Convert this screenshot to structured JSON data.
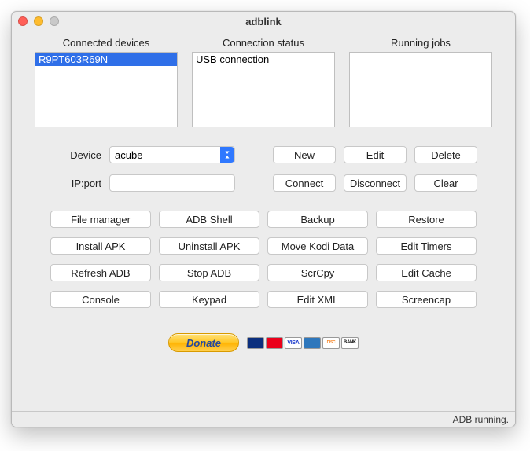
{
  "window": {
    "title": "adblink"
  },
  "panes": {
    "connected_devices": {
      "label": "Connected devices",
      "items": [
        "R9PT603R69N"
      ],
      "selected_index": 0
    },
    "connection_status": {
      "label": "Connection status",
      "text": "USB connection"
    },
    "running_jobs": {
      "label": "Running jobs",
      "text": ""
    }
  },
  "form": {
    "device_label": "Device",
    "device_value": "acube",
    "ipport_label": "IP:port",
    "ipport_value": "",
    "buttons": {
      "new": "New",
      "edit": "Edit",
      "delete": "Delete",
      "connect": "Connect",
      "disconnect": "Disconnect",
      "clear": "Clear"
    }
  },
  "grid": {
    "file_manager": "File manager",
    "adb_shell": "ADB Shell",
    "backup": "Backup",
    "restore": "Restore",
    "install_apk": "Install APK",
    "uninstall_apk": "Uninstall APK",
    "move_kodi": "Move Kodi Data",
    "edit_timers": "Edit Timers",
    "refresh_adb": "Refresh ADB",
    "stop_adb": "Stop ADB",
    "scrcpy": "ScrCpy",
    "edit_cache": "Edit Cache",
    "console": "Console",
    "keypad": "Keypad",
    "edit_xml": "Edit XML",
    "screencap": "Screencap"
  },
  "donate": {
    "button": "Donate"
  },
  "status": "ADB running."
}
